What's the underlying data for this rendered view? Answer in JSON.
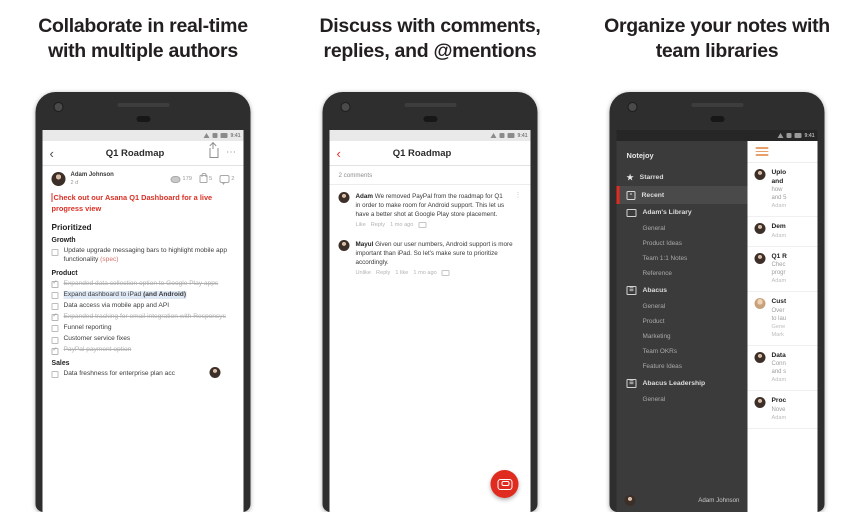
{
  "panels": [
    {
      "headline": "Collaborate in real-time\nwith multiple authors",
      "headline_l1": "Collaborate in real-time",
      "headline_l2": "with multiple authors"
    },
    {
      "headline_l1": "Discuss with comments,",
      "headline_l2": "replies, and @mentions"
    },
    {
      "headline_l1": "Organize your notes with",
      "headline_l2": "team libraries"
    }
  ],
  "status_bar": {
    "time": "9:41"
  },
  "note_screen": {
    "appbar": {
      "back": "‹",
      "title": "Q1 Roadmap",
      "menu": "⋯"
    },
    "author": {
      "name": "Adam Johnson",
      "time": "2 d"
    },
    "stats": {
      "views": "179",
      "likes": "5",
      "comments": "2"
    },
    "red_note": "Check out our Asana Q1 Dashboard for a live progress view",
    "section_prioritized": "Prioritized",
    "groups": [
      {
        "title": "Growth",
        "items": [
          {
            "text": "Update upgrade messaging bars to highlight mobile app functionality ",
            "tag": "(spec)",
            "done": false,
            "highlight": false,
            "link": false
          }
        ]
      },
      {
        "title": "Product",
        "items": [
          {
            "text": "Expanded data collection option to Google Play apps",
            "tag": "",
            "done": true,
            "highlight": false,
            "link": false
          },
          {
            "text": "Expand dashboard to iPad ",
            "bold_tail": "(and Android)",
            "tag": "",
            "done": false,
            "highlight": true,
            "link": false
          },
          {
            "text": "Data access via mobile app and API",
            "tag": "",
            "done": false,
            "highlight": false,
            "link": false
          },
          {
            "text": "Expanded tracking for email integration with Responsys",
            "tag": "",
            "done": true,
            "highlight": false,
            "link": false
          },
          {
            "text": "Funnel reporting",
            "tag": "",
            "done": false,
            "highlight": false,
            "link": false
          },
          {
            "text": "Customer service fixes",
            "tag": "",
            "done": false,
            "highlight": false,
            "link": false
          },
          {
            "text": "PayPal payment option",
            "tag": "",
            "done": true,
            "highlight": false,
            "link": true
          }
        ]
      },
      {
        "title": "Sales",
        "items": [
          {
            "text": "Data freshness for enterprise plan acc",
            "tag": "",
            "done": false,
            "highlight": false,
            "link": false
          }
        ]
      }
    ]
  },
  "comments_screen": {
    "appbar": {
      "back": "‹",
      "title": "Q1 Roadmap"
    },
    "count_label": "2 comments",
    "comments": [
      {
        "name": "Adam",
        "text": "We removed PayPal from the roadmap for Q1 in order to make room for Android support. This let us have a better shot at Google Play store placement.",
        "meta": [
          "Like",
          "Reply",
          "1 mo ago"
        ]
      },
      {
        "name": "Mayul",
        "text": "Given our user numbers, Android support is more important than iPad. So let's make sure to prioritize accordingly.",
        "meta": [
          "Unlike",
          "Reply",
          "1 like",
          "1 mo ago"
        ]
      }
    ],
    "fab": "new-comment"
  },
  "library_screen": {
    "brand": "Notejoy",
    "nav": [
      {
        "label": "Starred",
        "icon": "star-icon",
        "type": "item",
        "active": false
      },
      {
        "label": "Recent",
        "icon": "clock-icon",
        "type": "item",
        "active": true
      },
      {
        "label": "Adam's Library",
        "icon": "folder-icon",
        "type": "item",
        "active": false
      },
      {
        "label": "General",
        "type": "sub"
      },
      {
        "label": "Product Ideas",
        "type": "sub"
      },
      {
        "label": "Team 1:1 Notes",
        "type": "sub"
      },
      {
        "label": "Reference",
        "type": "sub"
      },
      {
        "label": "Abacus",
        "icon": "team-icon",
        "type": "item",
        "active": false
      },
      {
        "label": "General",
        "type": "sub"
      },
      {
        "label": "Product",
        "type": "sub"
      },
      {
        "label": "Marketing",
        "type": "sub"
      },
      {
        "label": "Team OKRs",
        "type": "sub"
      },
      {
        "label": "Feature Ideas",
        "type": "sub"
      },
      {
        "label": "Abacus Leadership",
        "icon": "team-icon",
        "type": "item",
        "active": false
      },
      {
        "label": "General",
        "type": "sub"
      }
    ],
    "footer_user": "Adam Johnson",
    "notes": [
      {
        "title": "Uplo",
        "title2": "and",
        "snippet": "how",
        "snippet2": "and 5",
        "meta": "Adam",
        "avatar": "dark"
      },
      {
        "title": "Dem",
        "title2": "",
        "snippet": "",
        "snippet2": "",
        "meta": "Adam",
        "avatar": "dark"
      },
      {
        "title": "Q1 R",
        "title2": "",
        "snippet": "Chec",
        "snippet2": "progr",
        "meta": "Adam",
        "avatar": "dark"
      },
      {
        "title": "Cust",
        "title2": "",
        "snippet": "Over",
        "snippet2": "to lau",
        "meta": "Gene",
        "meta2": "Mark",
        "avatar": "light"
      },
      {
        "title": "Data",
        "title2": "",
        "snippet": "Conn",
        "snippet2": "and s",
        "meta": "Adam",
        "avatar": "dark"
      },
      {
        "title": "Proc",
        "title2": "",
        "snippet": "Nove",
        "snippet2": "",
        "meta": "Adam",
        "avatar": "dark"
      }
    ]
  },
  "colors": {
    "accent_red": "#e02b20",
    "note_red": "#d93025",
    "sidebar": "#3b3b3b",
    "burger": "#e8a06a"
  }
}
